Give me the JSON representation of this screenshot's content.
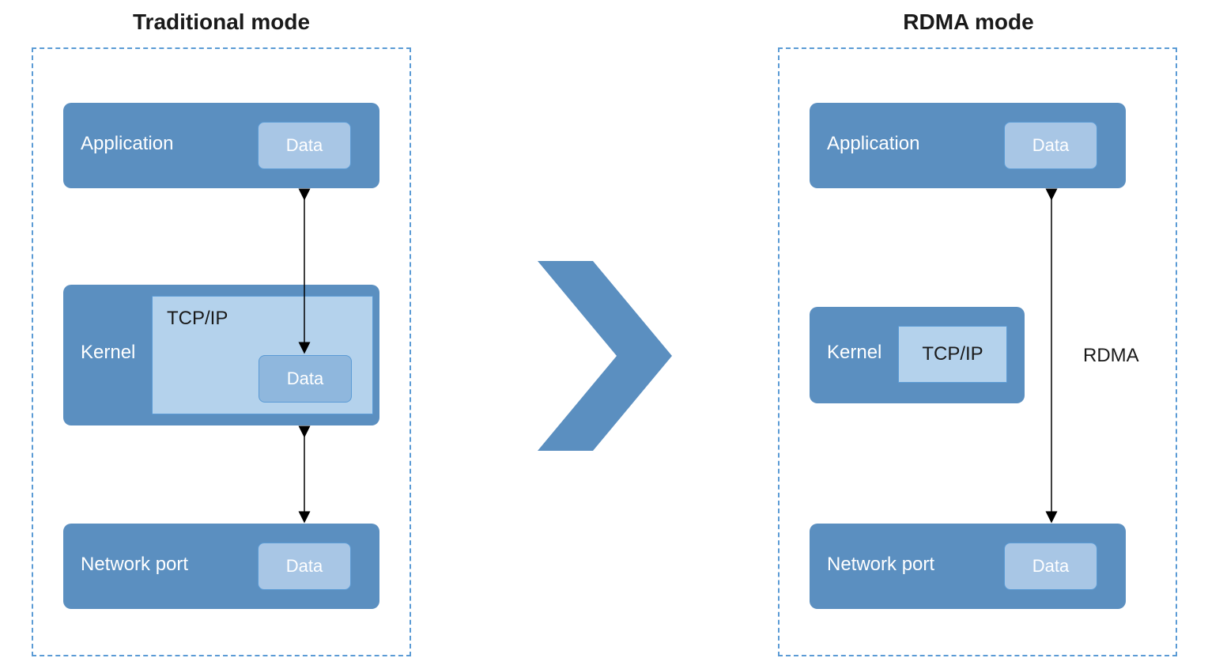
{
  "left": {
    "title": "Traditional mode",
    "application": {
      "label": "Application",
      "data": "Data"
    },
    "kernel": {
      "label": "Kernel",
      "tcpip": "TCP/IP",
      "data": "Data"
    },
    "network": {
      "label": "Network port",
      "data": "Data"
    }
  },
  "right": {
    "title": "RDMA mode",
    "application": {
      "label": "Application",
      "data": "Data"
    },
    "kernel": {
      "label": "Kernel",
      "tcpip": "TCP/IP"
    },
    "network": {
      "label": "Network port",
      "data": "Data"
    },
    "rdma_label": "RDMA"
  }
}
